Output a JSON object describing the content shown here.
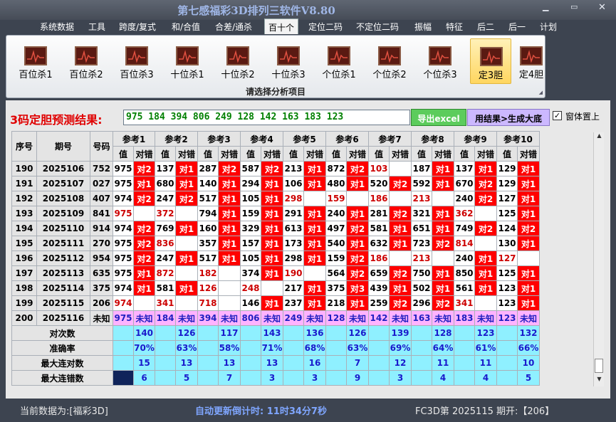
{
  "window": {
    "title": "第七感福彩3D排列三软件V8.80"
  },
  "menu": [
    {
      "label": "系统数据",
      "name": "menu-system-data",
      "selected": false
    },
    {
      "label": "工具",
      "name": "menu-tools",
      "selected": false
    },
    {
      "label": "跨度/复式",
      "name": "menu-span-compound",
      "selected": false
    },
    {
      "label": "和/合值",
      "name": "menu-sum-value",
      "selected": false
    },
    {
      "label": "合差/通杀",
      "name": "menu-diff-kill",
      "selected": false
    },
    {
      "label": "百十个",
      "name": "menu-positions",
      "selected": true
    },
    {
      "label": "定位二码",
      "name": "menu-fixed-two",
      "selected": false
    },
    {
      "label": "不定位二码",
      "name": "menu-unfixed-two",
      "selected": false
    },
    {
      "label": "振幅",
      "name": "menu-amplitude",
      "selected": false
    },
    {
      "label": "特征",
      "name": "menu-features",
      "selected": false
    },
    {
      "label": "后二",
      "name": "menu-last-two",
      "selected": false
    },
    {
      "label": "后一",
      "name": "menu-last-one",
      "selected": false
    },
    {
      "label": "计划",
      "name": "menu-plan",
      "selected": false
    }
  ],
  "ribbon": {
    "buttons": [
      {
        "label": "百位杀1",
        "selected": false
      },
      {
        "label": "百位杀2",
        "selected": false
      },
      {
        "label": "百位杀3",
        "selected": false
      },
      {
        "label": "十位杀1",
        "selected": false
      },
      {
        "label": "十位杀2",
        "selected": false
      },
      {
        "label": "十位杀3",
        "selected": false
      },
      {
        "label": "个位杀1",
        "selected": false
      },
      {
        "label": "个位杀2",
        "selected": false
      },
      {
        "label": "个位杀3",
        "selected": false
      },
      {
        "label": "定3胆",
        "selected": true
      },
      {
        "label": "定4胆",
        "selected": false
      }
    ],
    "icon": "chart-icon",
    "caption": "请选择分析项目"
  },
  "prediction": {
    "label": "3码定胆预测结果:",
    "value": "975 184 394 806 249 128 142 163 183 123",
    "export_label": "导出excel",
    "generate_label": "用结果>生成大底",
    "ontop_label": "窗体置上",
    "ontop_checked": "✓"
  },
  "table": {
    "headers": {
      "idx": "序号",
      "period": "期号",
      "number": "号码",
      "value": "值",
      "hit": "对错"
    },
    "refs": [
      "参考1",
      "参考2",
      "参考3",
      "参考4",
      "参考5",
      "参考6",
      "参考7",
      "参考8",
      "参考9",
      "参考10"
    ],
    "rows": [
      {
        "idx": "190",
        "period": "2025106",
        "number": "752",
        "cells": [
          [
            "975",
            "对2"
          ],
          [
            "137",
            "对1"
          ],
          [
            "287",
            "对2"
          ],
          [
            "587",
            "对2"
          ],
          [
            "213",
            "对1"
          ],
          [
            "872",
            "对2"
          ],
          [
            "103",
            ""
          ],
          [
            "187",
            "对1"
          ],
          [
            "137",
            "对1"
          ],
          [
            "129",
            "对1"
          ]
        ]
      },
      {
        "idx": "191",
        "period": "2025107",
        "number": "027",
        "cells": [
          [
            "975",
            "对1"
          ],
          [
            "680",
            "对1"
          ],
          [
            "140",
            "对1"
          ],
          [
            "294",
            "对1"
          ],
          [
            "106",
            "对1"
          ],
          [
            "480",
            "对1"
          ],
          [
            "520",
            "对2"
          ],
          [
            "592",
            "对1"
          ],
          [
            "670",
            "对2"
          ],
          [
            "129",
            "对1"
          ]
        ]
      },
      {
        "idx": "192",
        "period": "2025108",
        "number": "407",
        "cells": [
          [
            "974",
            "对2"
          ],
          [
            "247",
            "对2"
          ],
          [
            "517",
            "对1"
          ],
          [
            "105",
            "对1"
          ],
          [
            "298",
            ""
          ],
          [
            "159",
            ""
          ],
          [
            "186",
            ""
          ],
          [
            "213",
            ""
          ],
          [
            "240",
            "对2"
          ],
          [
            "127",
            "对1"
          ]
        ]
      },
      {
        "idx": "193",
        "period": "2025109",
        "number": "841",
        "cells": [
          [
            "975",
            ""
          ],
          [
            "372",
            ""
          ],
          [
            "794",
            "对1"
          ],
          [
            "159",
            "对1"
          ],
          [
            "291",
            "对1"
          ],
          [
            "240",
            "对1"
          ],
          [
            "281",
            "对2"
          ],
          [
            "321",
            "对1"
          ],
          [
            "362",
            ""
          ],
          [
            "125",
            "对1"
          ]
        ]
      },
      {
        "idx": "194",
        "period": "2025110",
        "number": "914",
        "cells": [
          [
            "974",
            "对2"
          ],
          [
            "769",
            "对1"
          ],
          [
            "160",
            "对1"
          ],
          [
            "329",
            "对1"
          ],
          [
            "613",
            "对1"
          ],
          [
            "497",
            "对2"
          ],
          [
            "581",
            "对1"
          ],
          [
            "651",
            "对1"
          ],
          [
            "749",
            "对2"
          ],
          [
            "124",
            "对2"
          ]
        ]
      },
      {
        "idx": "195",
        "period": "2025111",
        "number": "270",
        "cells": [
          [
            "975",
            "对2"
          ],
          [
            "836",
            ""
          ],
          [
            "357",
            "对1"
          ],
          [
            "157",
            "对1"
          ],
          [
            "173",
            "对1"
          ],
          [
            "540",
            "对1"
          ],
          [
            "632",
            "对1"
          ],
          [
            "723",
            "对2"
          ],
          [
            "814",
            ""
          ],
          [
            "130",
            "对1"
          ]
        ]
      },
      {
        "idx": "196",
        "period": "2025112",
        "number": "954",
        "cells": [
          [
            "975",
            "对2"
          ],
          [
            "247",
            "对1"
          ],
          [
            "517",
            "对1"
          ],
          [
            "105",
            "对1"
          ],
          [
            "298",
            "对1"
          ],
          [
            "159",
            "对2"
          ],
          [
            "186",
            ""
          ],
          [
            "213",
            ""
          ],
          [
            "240",
            "对1"
          ],
          [
            "127",
            ""
          ]
        ]
      },
      {
        "idx": "197",
        "period": "2025113",
        "number": "635",
        "cells": [
          [
            "975",
            "对1"
          ],
          [
            "872",
            ""
          ],
          [
            "182",
            ""
          ],
          [
            "374",
            "对1"
          ],
          [
            "190",
            ""
          ],
          [
            "564",
            "对2"
          ],
          [
            "659",
            "对2"
          ],
          [
            "750",
            "对1"
          ],
          [
            "850",
            "对1"
          ],
          [
            "125",
            "对1"
          ]
        ]
      },
      {
        "idx": "198",
        "period": "2025114",
        "number": "375",
        "cells": [
          [
            "974",
            "对1"
          ],
          [
            "581",
            "对1"
          ],
          [
            "126",
            ""
          ],
          [
            "248",
            ""
          ],
          [
            "217",
            "对1"
          ],
          [
            "375",
            "对3"
          ],
          [
            "439",
            "对1"
          ],
          [
            "502",
            "对1"
          ],
          [
            "561",
            "对1"
          ],
          [
            "123",
            "对1"
          ]
        ]
      },
      {
        "idx": "199",
        "period": "2025115",
        "number": "206",
        "cells": [
          [
            "974",
            ""
          ],
          [
            "341",
            ""
          ],
          [
            "718",
            ""
          ],
          [
            "146",
            "对1"
          ],
          [
            "237",
            "对1"
          ],
          [
            "218",
            "对1"
          ],
          [
            "259",
            "对2"
          ],
          [
            "296",
            "对2"
          ],
          [
            "341",
            ""
          ],
          [
            "123",
            "对1"
          ]
        ]
      }
    ],
    "pending": {
      "idx": "200",
      "period": "2025116",
      "number": "未知",
      "values": [
        "975",
        "184",
        "394",
        "806",
        "249",
        "128",
        "142",
        "163",
        "183",
        "123"
      ],
      "status": "未知"
    },
    "stats": [
      {
        "label": "对次数",
        "values": [
          "140",
          "126",
          "117",
          "143",
          "136",
          "126",
          "139",
          "128",
          "123",
          "132"
        ]
      },
      {
        "label": "准确率",
        "values": [
          "70%",
          "63%",
          "58%",
          "71%",
          "68%",
          "63%",
          "69%",
          "64%",
          "61%",
          "66%"
        ]
      },
      {
        "label": "最大连对数",
        "values": [
          "15",
          "13",
          "13",
          "13",
          "16",
          "7",
          "12",
          "11",
          "11",
          "10"
        ]
      },
      {
        "label": "最大连错数",
        "values": [
          "6",
          "5",
          "7",
          "3",
          "3",
          "9",
          "3",
          "4",
          "4",
          "5"
        ]
      }
    ]
  },
  "status": {
    "left": "当前数据为:[福彩3D]",
    "countdown": "自动更新倒计时:  11时34分7秒",
    "right": "FC3D第 2025115 期开:【206】"
  }
}
